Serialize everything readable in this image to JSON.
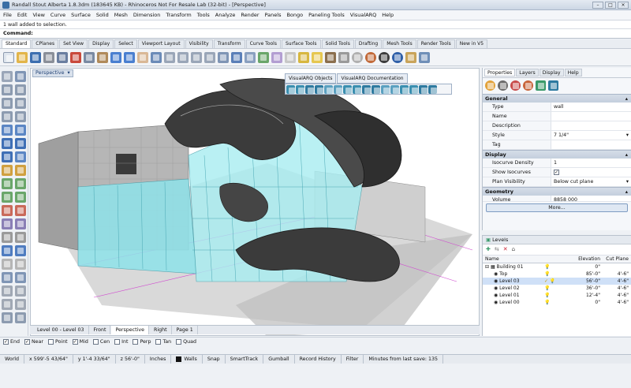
{
  "window": {
    "title": "Randall Stout Alberta 1.8.3dm (183645 KB) - Rhinoceros Not For Resale Lab (32-bit) - [Perspective]"
  },
  "menu": [
    "File",
    "Edit",
    "View",
    "Curve",
    "Surface",
    "Solid",
    "Mesh",
    "Dimension",
    "Transform",
    "Tools",
    "Analyze",
    "Render",
    "Panels",
    "Bongo",
    "Paneling Tools",
    "VisualARQ",
    "Help"
  ],
  "command": {
    "history": "1 wall added to selection.",
    "prompt": "Command:"
  },
  "toolbar_tabs": [
    "Standard",
    "CPlanes",
    "Set View",
    "Display",
    "Select",
    "Viewport Layout",
    "Visibility",
    "Transform",
    "Curve Tools",
    "Surface Tools",
    "Solid Tools",
    "Drafting",
    "Mesh Tools",
    "Render Tools",
    "New in V5"
  ],
  "viewport": {
    "label": "Perspective",
    "dropdown": "▾",
    "floating_tabs": [
      "VisualARQ Objects",
      "VisualARQ Documentation"
    ],
    "bottom_tabs": [
      "Level 00 - Level 03",
      "Front",
      "Perspective",
      "Right",
      "Page 1"
    ],
    "active_tab": "Perspective"
  },
  "osnap": [
    {
      "label": "End",
      "checked": true
    },
    {
      "label": "Near",
      "checked": true
    },
    {
      "label": "Point",
      "checked": false
    },
    {
      "label": "Mid",
      "checked": true
    },
    {
      "label": "Cen",
      "checked": false
    },
    {
      "label": "Int",
      "checked": false
    },
    {
      "label": "Perp",
      "checked": false
    },
    {
      "label": "Tan",
      "checked": false
    },
    {
      "label": "Quad",
      "checked": false
    }
  ],
  "status": {
    "cplane": "World",
    "x": "x 599'-5 43/64\"",
    "y": "y 1'-4 33/64\"",
    "z": "z 56'-0\"",
    "units": "Inches",
    "layer": "Walls",
    "osnap_btn": "Snap",
    "smarttrack": "SmartTrack",
    "gumball": "Gumball",
    "history": "Record History",
    "filter": "Filter",
    "save": "Minutes from last save: 135"
  },
  "properties": {
    "tabs": [
      "Properties",
      "Layers",
      "Display",
      "Help"
    ],
    "sections": {
      "general": "General",
      "display": "Display",
      "geometry": "Geometry"
    },
    "general_rows": [
      {
        "key": "Type",
        "value": "wall"
      },
      {
        "key": "Name",
        "value": ""
      },
      {
        "key": "Description",
        "value": ""
      },
      {
        "key": "Style",
        "value": "7 1/4\""
      },
      {
        "key": "Tag",
        "value": ""
      }
    ],
    "display_rows": [
      {
        "key": "Isocurve Density",
        "value": "1"
      },
      {
        "key": "Show Isocurves",
        "value": "✓"
      },
      {
        "key": "Plan Visibility",
        "value": "Below cut plane"
      }
    ],
    "geometry_row": {
      "key": "Volume",
      "value": "8858 000"
    },
    "more_button": "More..."
  },
  "levels": {
    "title": "Levels",
    "columns": {
      "name": "Name",
      "elevation": "Elevation",
      "cut": "Cut Plane"
    },
    "rows": [
      {
        "name": "Building 01",
        "elev": "0\"",
        "cut": ""
      },
      {
        "name": "Top",
        "elev": "85'-0\"",
        "cut": "4'-6\""
      },
      {
        "name": "Level 03",
        "elev": "56'-0\"",
        "cut": "4'-6\""
      },
      {
        "name": "Level 02",
        "elev": "36'-0\"",
        "cut": "4'-6\""
      },
      {
        "name": "Level 01",
        "elev": "12'-4\"",
        "cut": "4'-6\""
      },
      {
        "name": "Level 00",
        "elev": "0\"",
        "cut": "4'-6\""
      }
    ]
  },
  "colors": {
    "accent": "#3a6ea5",
    "glass": "#8fe3ea",
    "roof": "#3b3b3b",
    "stone": "#b8b8b8"
  },
  "icons": {
    "bulb": "lightbulb-icon",
    "lock": "lock-icon",
    "eye": "eye-icon"
  }
}
